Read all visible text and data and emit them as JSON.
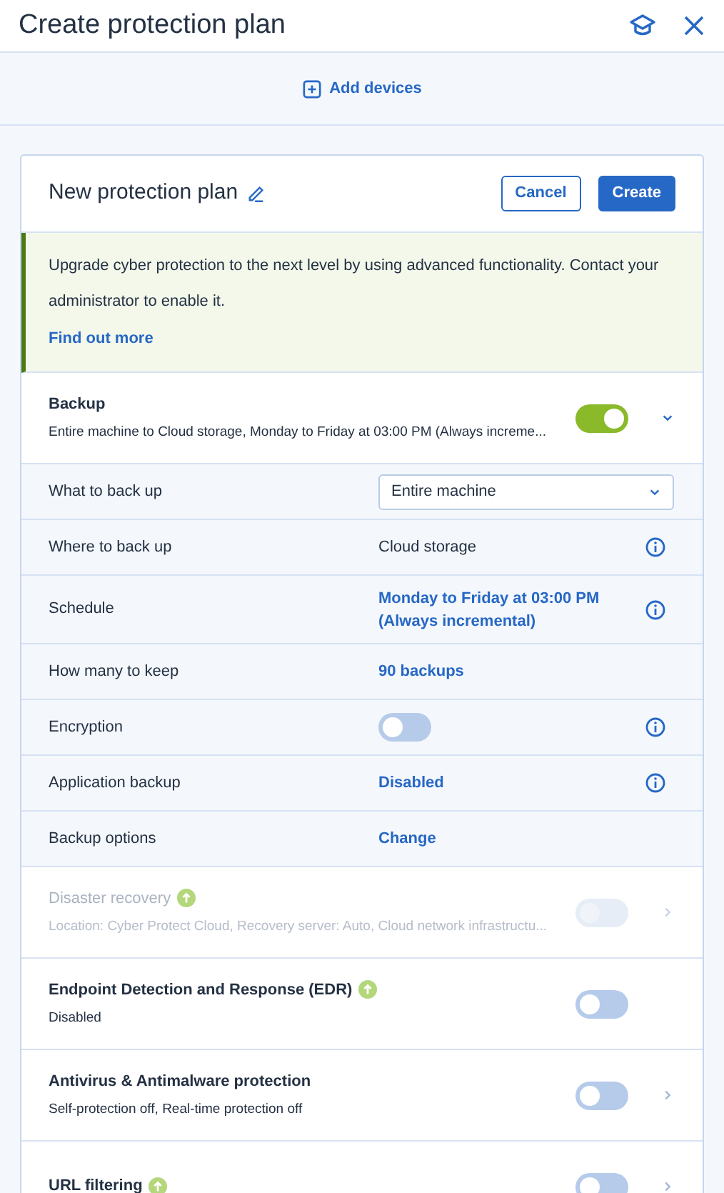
{
  "header": {
    "title": "Create protection plan"
  },
  "add_devices": {
    "label": "Add devices"
  },
  "plan": {
    "name": "New protection plan",
    "buttons": [
      {
        "label": "Cancel",
        "kind": "secondary"
      },
      {
        "label": "Create",
        "kind": "primary"
      }
    ]
  },
  "banner": {
    "text": "Upgrade cyber protection to the next level by using advanced functionality. Contact your administrator to enable it.",
    "link": "Find out more"
  },
  "modules": [
    {
      "title": "Backup",
      "subtitle": "Entire machine to Cloud storage, Monday to Friday at 03:00 PM (Always increme...",
      "on": true,
      "disabled": false,
      "upgrade": false,
      "expandable": true,
      "expanded": true,
      "settings": [
        {
          "label": "What to back up",
          "kind": "select",
          "value": "Entire machine",
          "info": false
        },
        {
          "label": "Where to back up",
          "kind": "text",
          "value": "Cloud storage",
          "info": true
        },
        {
          "label": "Schedule",
          "kind": "link",
          "value": "Monday to Friday at 03:00 PM (Always incremental)",
          "info": true
        },
        {
          "label": "How many to keep",
          "kind": "link",
          "value": "90 backups",
          "info": false
        },
        {
          "label": "Encryption",
          "kind": "toggle",
          "on": false,
          "info": true
        },
        {
          "label": "Application backup",
          "kind": "link",
          "value": "Disabled",
          "info": true
        },
        {
          "label": "Backup options",
          "kind": "link",
          "value": "Change",
          "info": false
        }
      ]
    },
    {
      "title": "Disaster recovery",
      "subtitle": "Location: Cyber Protect Cloud, Recovery server: Auto, Cloud network infrastructu...",
      "on": false,
      "disabled": true,
      "upgrade": true,
      "expandable": true,
      "expanded": false
    },
    {
      "title": "Endpoint Detection and Response (EDR)",
      "subtitle": "Disabled",
      "on": false,
      "disabled": false,
      "upgrade": true,
      "expandable": false,
      "expanded": false
    },
    {
      "title": "Antivirus & Antimalware protection",
      "subtitle": "Self-protection off, Real-time protection off",
      "on": false,
      "disabled": false,
      "upgrade": false,
      "expandable": true,
      "expanded": false
    },
    {
      "title": "URL filtering",
      "on": false,
      "disabled": false,
      "upgrade": true,
      "expandable": true,
      "expanded": false
    }
  ]
}
